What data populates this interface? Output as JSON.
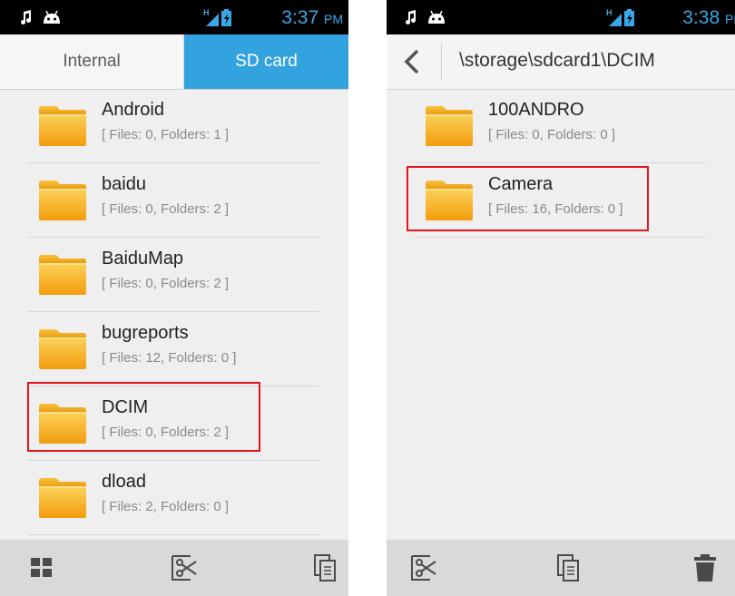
{
  "left_screen": {
    "status_time": "3:37",
    "status_ampm": "PM",
    "tabs": [
      {
        "label": "Internal"
      },
      {
        "label": "SD card"
      }
    ],
    "rows": [
      {
        "name": "Android",
        "info": "[ Files: 0, Folders: 1 ]"
      },
      {
        "name": "baidu",
        "info": "[ Files: 0, Folders: 2 ]"
      },
      {
        "name": "BaiduMap",
        "info": "[ Files: 0, Folders: 2 ]"
      },
      {
        "name": "bugreports",
        "info": "[ Files: 12, Folders: 0 ]"
      },
      {
        "name": "DCIM",
        "info": "[ Files: 0, Folders: 2 ]"
      },
      {
        "name": "dload",
        "info": "[ Files: 2, Folders: 0 ]"
      }
    ],
    "bottom_actions": [
      "grid-view-icon",
      "cut-icon",
      "copy-icon"
    ]
  },
  "right_screen": {
    "status_time": "3:38",
    "status_ampm": "PM",
    "path": "\\storage\\sdcard1\\DCIM",
    "rows": [
      {
        "name": "100ANDRO",
        "info": "[ Files: 0, Folders: 0 ]"
      },
      {
        "name": "Camera",
        "info": "[ Files: 16, Folders: 0 ]"
      }
    ],
    "bottom_actions": [
      "cut-icon",
      "copy-icon",
      "delete-icon"
    ]
  },
  "colors": {
    "accent": "#33a3e0",
    "highlight": "#e3141b",
    "folder": "#f6b21a"
  }
}
